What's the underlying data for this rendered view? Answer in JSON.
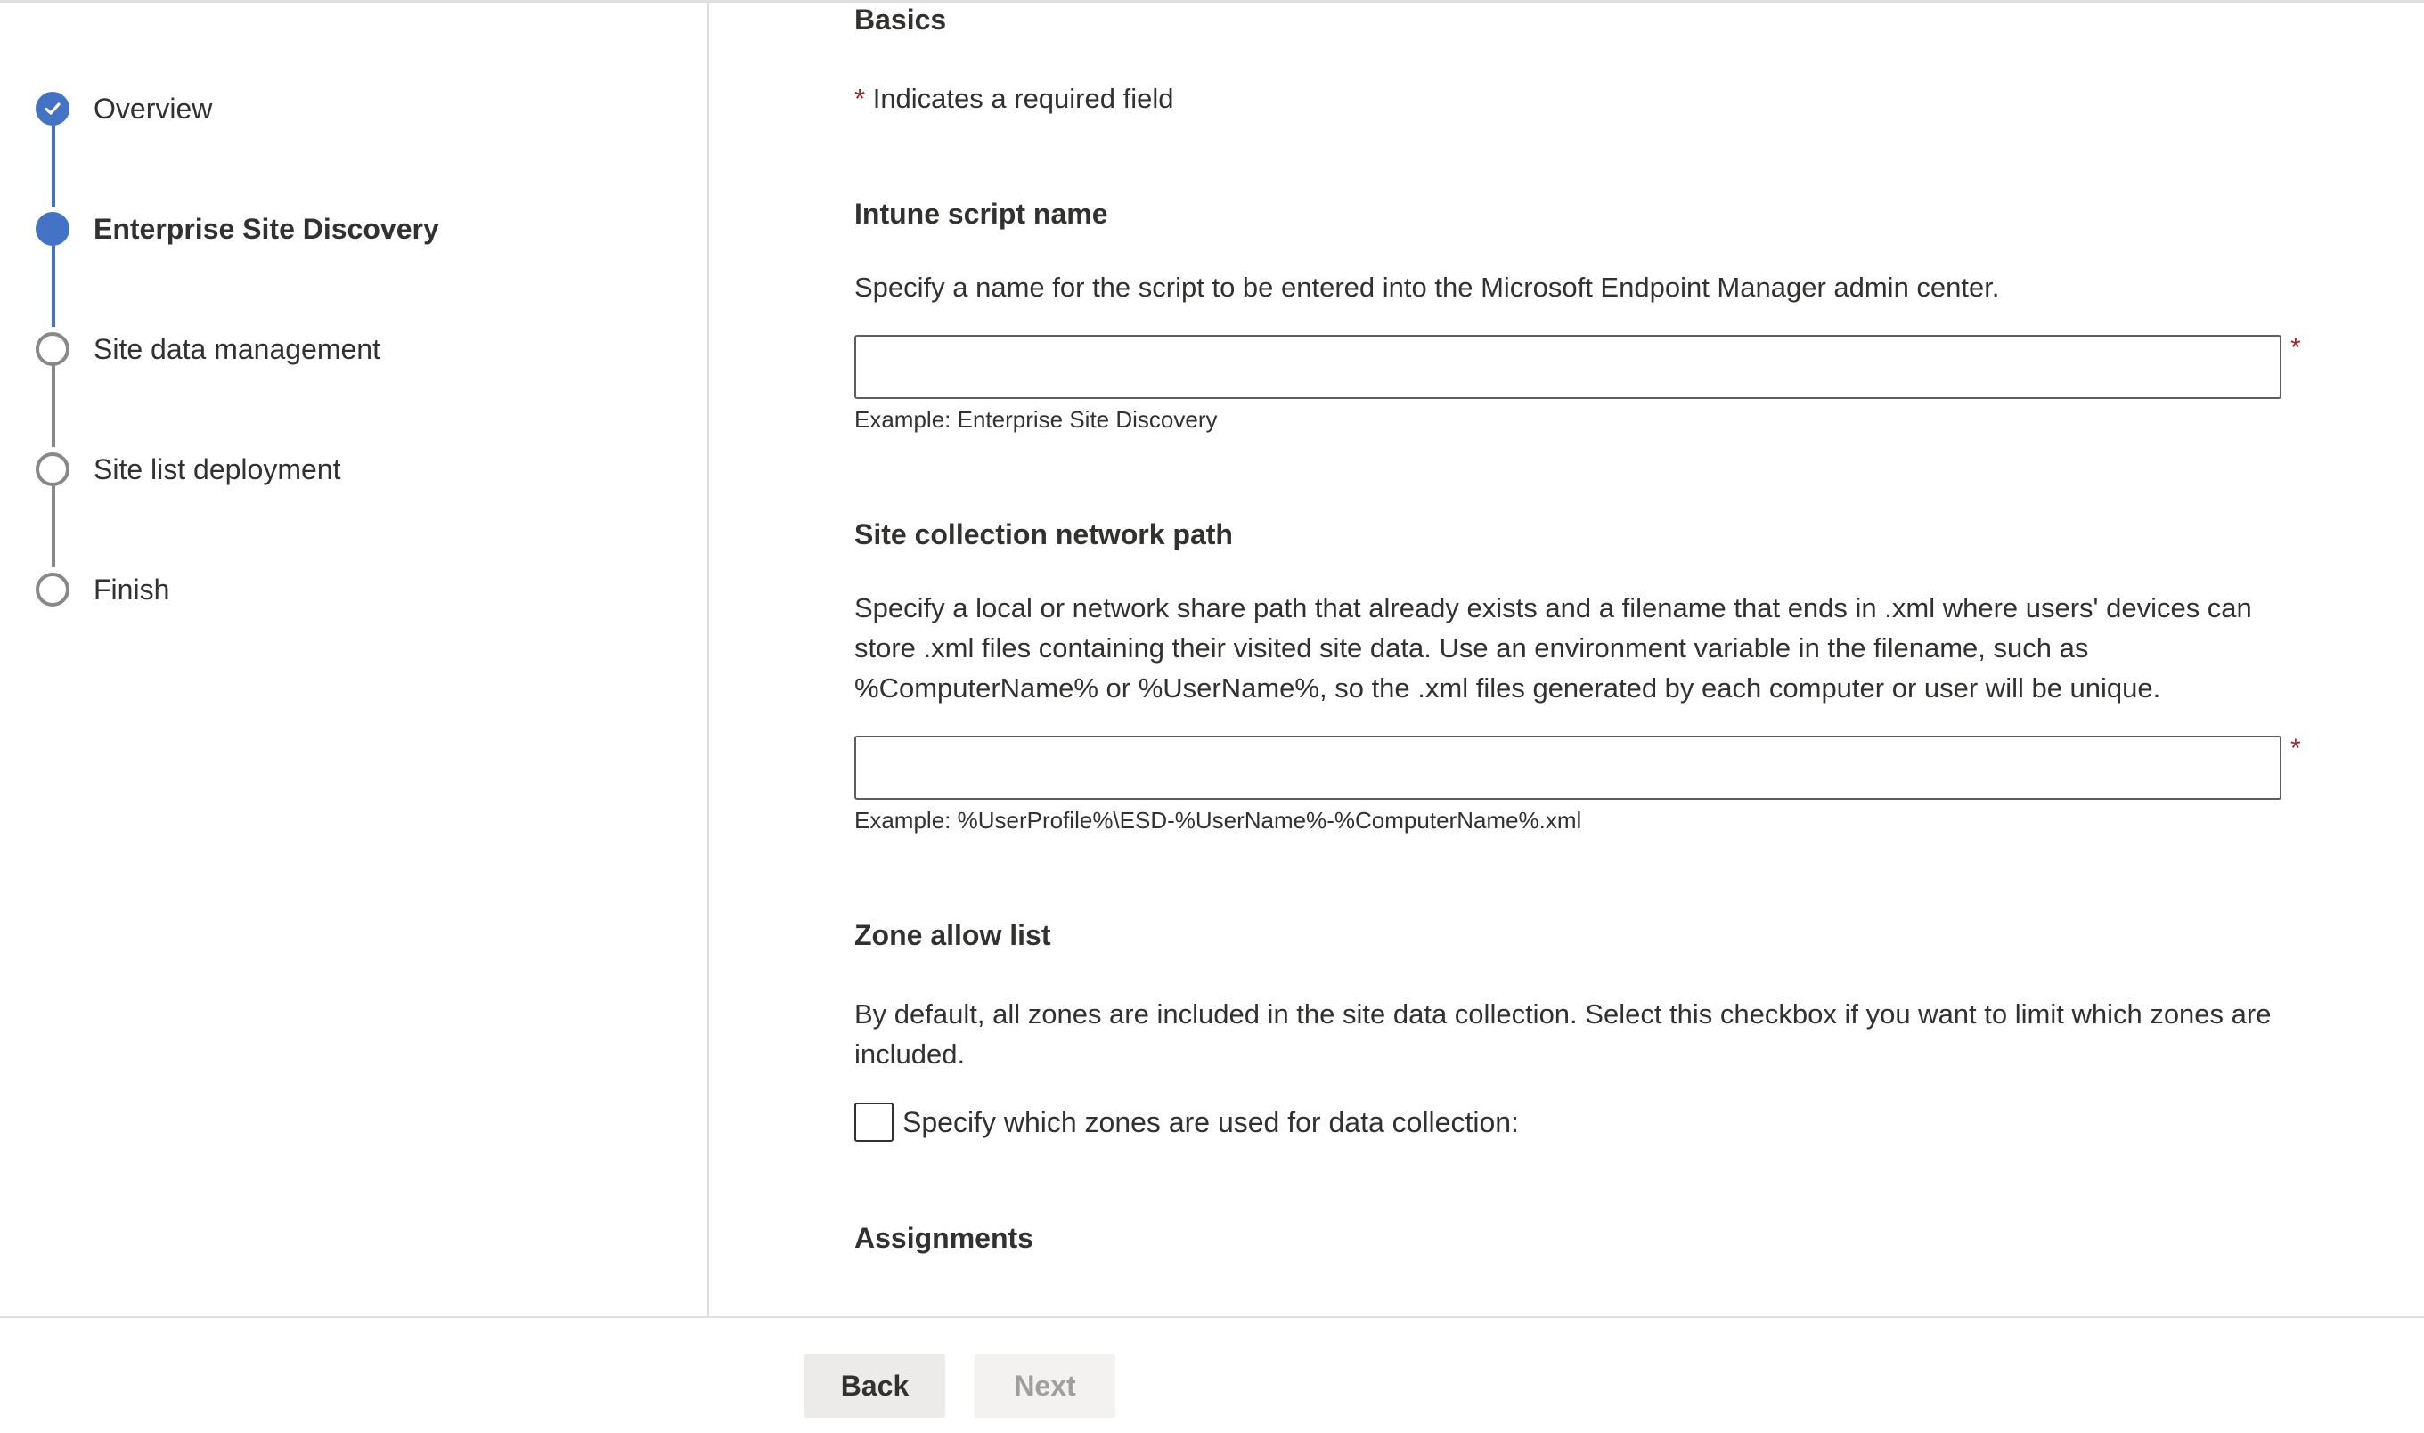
{
  "stepper": {
    "steps": [
      {
        "label": "Overview",
        "state": "done"
      },
      {
        "label": "Enterprise Site Discovery",
        "state": "current"
      },
      {
        "label": "Site data management",
        "state": "pending"
      },
      {
        "label": "Site list deployment",
        "state": "pending"
      },
      {
        "label": "Finish",
        "state": "pending"
      }
    ]
  },
  "form": {
    "section_title": "Basics",
    "required_star": "*",
    "required_note": "Indicates a required field",
    "script_name": {
      "heading": "Intune script name",
      "description": "Specify a name for the script to be entered into the Microsoft Endpoint Manager admin center.",
      "value": "",
      "example": "Example: Enterprise Site Discovery"
    },
    "network_path": {
      "heading": "Site collection network path",
      "description": "Specify a local or network share path that already exists and a filename that ends in .xml where users' devices can store .xml files containing their visited site data. Use an environment variable in the filename, such as %ComputerName% or %UserName%, so the .xml files generated by each computer or user will be unique.",
      "value": "",
      "example": "Example: %UserProfile%\\ESD-%UserName%-%ComputerName%.xml"
    },
    "zone_allow_list": {
      "heading": "Zone allow list",
      "description": "By default, all zones are included in the site data collection. Select this checkbox if you want to limit which zones are included.",
      "checkbox_label": "Specify which zones are used for data collection:",
      "checked": false
    },
    "assignments_heading": "Assignments"
  },
  "footer": {
    "back_label": "Back",
    "next_label": "Next"
  },
  "colors": {
    "accent": "#4472c4",
    "required": "#a4262c",
    "border": "#605e5c"
  }
}
